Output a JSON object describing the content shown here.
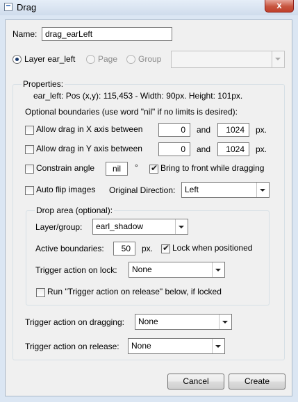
{
  "window": {
    "title": "Drag",
    "close_glyph": "x"
  },
  "name": {
    "label": "Name:",
    "value": "drag_earLeft"
  },
  "scope": {
    "layer_label": "Layer ear_left",
    "page_label": "Page",
    "group_label": "Group",
    "group_select": ""
  },
  "properties": {
    "legend": "Properties:",
    "info": "ear_left: Pos (x,y): 115,453 - Width: 90px. Height: 101px.",
    "boundaries_hint": "Optional boundaries (use word \"nil\" if no limits is desired):",
    "x_axis": {
      "label": "Allow drag in X axis between",
      "min": "0",
      "and": "and",
      "max": "1024",
      "unit": "px."
    },
    "y_axis": {
      "label": "Allow drag in Y axis between",
      "min": "0",
      "and": "and",
      "max": "1024",
      "unit": "px."
    },
    "constrain": {
      "label": "Constrain angle",
      "value": "nil",
      "unit": "°"
    },
    "bring_front": {
      "label": "Bring to front while dragging"
    },
    "auto_flip": {
      "label": "Auto flip images"
    },
    "original_direction": {
      "label": "Original Direction:",
      "value": "Left"
    }
  },
  "drop_area": {
    "legend": "Drop area (optional):",
    "layer_group_label": "Layer/group:",
    "layer_group_value": "earl_shadow",
    "active_label": "Active boundaries:",
    "active_value": "50",
    "active_unit": "px.",
    "lock_label": "Lock when positioned",
    "trigger_lock_label": "Trigger action on lock:",
    "trigger_lock_value": "None",
    "run_label": "Run \"Trigger action on release\" below, if locked"
  },
  "triggers": {
    "dragging_label": "Trigger action on dragging:",
    "dragging_value": "None",
    "release_label": "Trigger action on release:",
    "release_value": "None"
  },
  "buttons": {
    "cancel": "Cancel",
    "create": "Create"
  },
  "colors": {
    "titlebar": "#cfdcec",
    "client_bg": "#f0f0f0",
    "close": "#c7553f"
  }
}
